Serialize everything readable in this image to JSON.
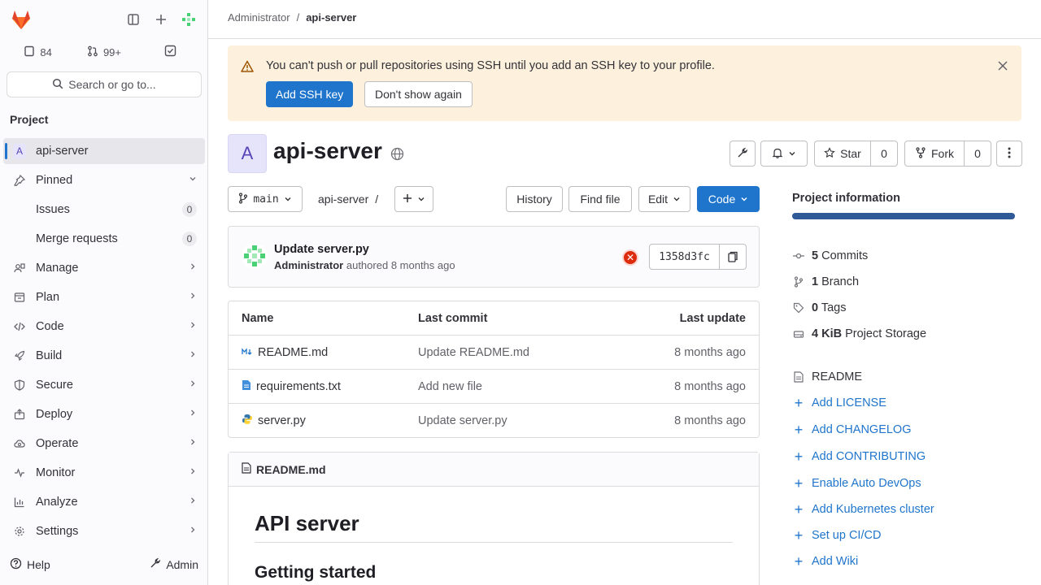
{
  "sidebar": {
    "counts": {
      "issues": "84",
      "merge_requests": "99+"
    },
    "search_label": "Search or go to...",
    "section_title": "Project",
    "project_avatar_letter": "A",
    "items": [
      {
        "label": "api-server",
        "icon": "project-avatar"
      },
      {
        "label": "Pinned",
        "icon": "pin-icon"
      },
      {
        "label": "Issues",
        "count": "0"
      },
      {
        "label": "Merge requests",
        "count": "0"
      },
      {
        "label": "Manage",
        "icon": "users-icon"
      },
      {
        "label": "Plan",
        "icon": "plan-icon"
      },
      {
        "label": "Code",
        "icon": "code-icon"
      },
      {
        "label": "Build",
        "icon": "rocket-icon"
      },
      {
        "label": "Secure",
        "icon": "shield-icon"
      },
      {
        "label": "Deploy",
        "icon": "deploy-icon"
      },
      {
        "label": "Operate",
        "icon": "cloud-gear-icon"
      },
      {
        "label": "Monitor",
        "icon": "monitor-icon"
      },
      {
        "label": "Analyze",
        "icon": "chart-icon"
      },
      {
        "label": "Settings",
        "icon": "gear-icon"
      }
    ],
    "help_label": "Help",
    "admin_label": "Admin"
  },
  "breadcrumb": {
    "parent": "Administrator",
    "current": "api-server",
    "separator": "/"
  },
  "alert": {
    "message": "You can't push or pull repositories using SSH until you add an SSH key to your profile.",
    "primary_button": "Add SSH key",
    "secondary_button": "Don't show again"
  },
  "project": {
    "avatar_letter": "A",
    "name": "api-server",
    "star_label": "Star",
    "star_count": "0",
    "fork_label": "Fork",
    "fork_count": "0"
  },
  "toolbar": {
    "branch": "main",
    "path_root": "api-server",
    "path_sep": "/",
    "history": "History",
    "find_file": "Find file",
    "edit": "Edit",
    "code": "Code"
  },
  "commit": {
    "title": "Update server.py",
    "author": "Administrator",
    "verb": "authored",
    "time": "8 months ago",
    "sha": "1358d3fc"
  },
  "files": {
    "headers": {
      "name": "Name",
      "last_commit": "Last commit",
      "last_update": "Last update"
    },
    "rows": [
      {
        "name": "README.md",
        "commit": "Update README.md",
        "updated": "8 months ago",
        "icon": "markdown-icon"
      },
      {
        "name": "requirements.txt",
        "commit": "Add new file",
        "updated": "8 months ago",
        "icon": "text-file-icon"
      },
      {
        "name": "server.py",
        "commit": "Update server.py",
        "updated": "8 months ago",
        "icon": "python-icon"
      }
    ]
  },
  "readme": {
    "filename": "README.md",
    "h1": "API server",
    "h2": "Getting started"
  },
  "project_info": {
    "title": "Project information",
    "commits_num": "5",
    "commits_label": "Commits",
    "branch_num": "1",
    "branch_label": "Branch",
    "tags_num": "0",
    "tags_label": "Tags",
    "storage_num": "4 KiB",
    "storage_label": "Project Storage",
    "readme_label": "README",
    "links": [
      "Add LICENSE",
      "Add CHANGELOG",
      "Add CONTRIBUTING",
      "Enable Auto DevOps",
      "Add Kubernetes cluster",
      "Set up CI/CD",
      "Add Wiki"
    ]
  },
  "colors": {
    "accent": "#1f75cb",
    "alert_bg": "#fdf1dd",
    "danger": "#dd2b0e"
  }
}
